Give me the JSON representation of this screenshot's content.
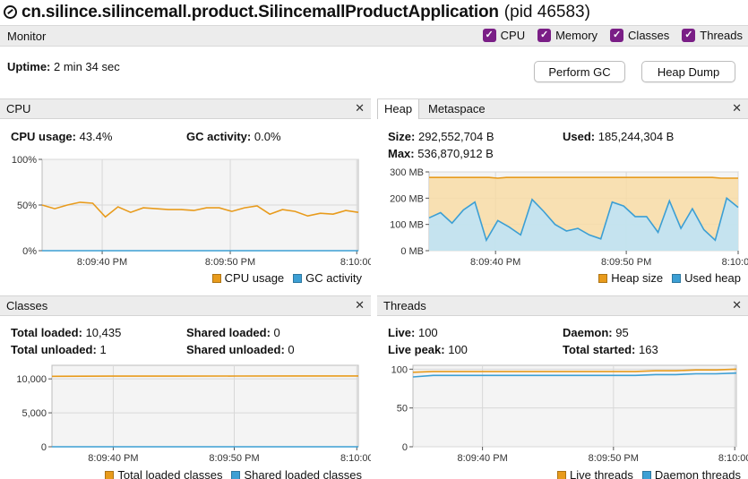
{
  "window": {
    "title": "cn.silince.silincemall.product.SilincemallProductApplication",
    "pid": "(pid 46583)"
  },
  "monitor": {
    "label": "Monitor",
    "checks": [
      {
        "label": "CPU",
        "checked": true
      },
      {
        "label": "Memory",
        "checked": true
      },
      {
        "label": "Classes",
        "checked": true
      },
      {
        "label": "Threads",
        "checked": true
      }
    ],
    "uptime_label": "Uptime:",
    "uptime_value": "2 min 34 sec",
    "perform_gc": "Perform GC",
    "heap_dump": "Heap Dump"
  },
  "colors": {
    "orange": "#e89b1c",
    "blue": "#3c9fd4",
    "accent": "#7a1e86"
  },
  "cpu": {
    "title": "CPU",
    "usage_label": "CPU usage:",
    "usage_value": "43.4%",
    "gc_label": "GC activity:",
    "gc_value": "0.0%",
    "legend": [
      "CPU usage",
      "GC activity"
    ],
    "chart_data": {
      "type": "line",
      "y_ticks": [
        "100%",
        "50%",
        "0%"
      ],
      "ylim": [
        0,
        100
      ],
      "x_ticks": [
        "8:09:40 PM",
        "8:09:50 PM",
        "8:10:00"
      ],
      "series": [
        {
          "name": "CPU usage",
          "values": [
            50,
            46,
            50,
            53,
            52,
            37,
            48,
            42,
            47,
            46,
            45,
            45,
            44,
            47,
            47,
            43,
            47,
            49,
            40,
            45,
            43,
            38,
            41,
            40,
            44,
            42
          ]
        },
        {
          "name": "GC activity",
          "values": [
            0,
            0,
            0,
            0,
            0,
            0,
            0,
            0,
            0,
            0,
            0,
            0,
            0,
            0,
            0,
            0,
            0,
            0,
            0,
            0,
            0,
            0,
            0,
            0,
            0,
            0
          ]
        }
      ]
    }
  },
  "heap": {
    "tab_heap": "Heap",
    "tab_meta": "Metaspace",
    "size_label": "Size:",
    "size_value": "292,552,704 B",
    "used_label": "Used:",
    "used_value": "185,244,304 B",
    "max_label": "Max:",
    "max_value": "536,870,912 B",
    "legend": [
      "Heap size",
      "Used heap"
    ],
    "chart_data": {
      "type": "area",
      "y_ticks": [
        "300 MB",
        "200 MB",
        "100 MB",
        "0 MB"
      ],
      "ylim": [
        0,
        300
      ],
      "x_ticks": [
        "8:09:40 PM",
        "8:09:50 PM",
        "8:10:00"
      ],
      "series": [
        {
          "name": "Heap size",
          "values": [
            279,
            279,
            279,
            279,
            279,
            279,
            279,
            279,
            276,
            279,
            279,
            279,
            279,
            279,
            279,
            279,
            279,
            279,
            279,
            279,
            279,
            279,
            279,
            279,
            279,
            279,
            279,
            279,
            279,
            279,
            279,
            279,
            279,
            279,
            276,
            276,
            276
          ]
        },
        {
          "name": "Used heap",
          "values": [
            125,
            145,
            105,
            155,
            185,
            40,
            115,
            90,
            60,
            195,
            150,
            100,
            75,
            85,
            60,
            45,
            185,
            170,
            130,
            130,
            70,
            190,
            85,
            160,
            80,
            40,
            200,
            165
          ]
        }
      ]
    }
  },
  "classes": {
    "title": "Classes",
    "total_loaded_label": "Total loaded:",
    "total_loaded_value": "10,435",
    "total_unloaded_label": "Total unloaded:",
    "total_unloaded_value": "1",
    "shared_loaded_label": "Shared loaded:",
    "shared_loaded_value": "0",
    "shared_unloaded_label": "Shared unloaded:",
    "shared_unloaded_value": "0",
    "legend": [
      "Total loaded classes",
      "Shared loaded classes"
    ],
    "chart_data": {
      "type": "line",
      "y_ticks": [
        "10,000",
        "5,000",
        "0"
      ],
      "ylim": [
        0,
        12000
      ],
      "x_ticks": [
        "8:09:40 PM",
        "8:09:50 PM",
        "8:10:00"
      ],
      "series": [
        {
          "name": "Total loaded classes",
          "values": [
            10380,
            10400,
            10410,
            10420,
            10430,
            10435
          ]
        },
        {
          "name": "Shared loaded classes",
          "values": [
            0,
            0,
            0,
            0,
            0,
            0
          ]
        }
      ]
    }
  },
  "threads": {
    "title": "Threads",
    "live_label": "Live:",
    "live_value": "100",
    "daemon_label": "Daemon:",
    "daemon_value": "95",
    "peak_label": "Live peak:",
    "peak_value": "100",
    "started_label": "Total started:",
    "started_value": "163",
    "legend": [
      "Live threads",
      "Daemon threads"
    ],
    "chart_data": {
      "type": "line",
      "y_ticks": [
        "100",
        "50",
        "0"
      ],
      "ylim": [
        0,
        105
      ],
      "x_ticks": [
        "8:09:40 PM",
        "8:09:50 PM",
        "8:10:00"
      ],
      "series": [
        {
          "name": "Live threads",
          "values": [
            96,
            97,
            97,
            97,
            97,
            97,
            97,
            97,
            97,
            97,
            97,
            97,
            98,
            98,
            99,
            99,
            100
          ]
        },
        {
          "name": "Daemon threads",
          "values": [
            90,
            92,
            92,
            92,
            92,
            92,
            92,
            92,
            92,
            92,
            92,
            92,
            93,
            93,
            94,
            94,
            95
          ]
        }
      ]
    }
  }
}
